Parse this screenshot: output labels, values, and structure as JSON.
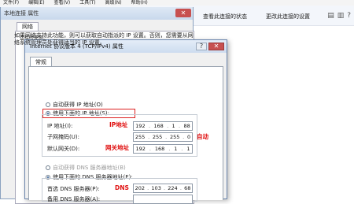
{
  "menubar": {
    "items": [
      "文件(F)",
      "编辑(E)",
      "查看(V)",
      "工具(T)",
      "高级(N)",
      "帮助(H)"
    ]
  },
  "bg_toolbar": {
    "view_status": "查看此连接的状态",
    "change_settings": "更改此连接的设置"
  },
  "bg_dialog": {
    "title": "本地连接 属性",
    "tab": "网络",
    "line": "连接时使用:"
  },
  "dialog": {
    "title": "Internet 协议版本 4 (TCP/IPv4) 属性",
    "tab": "常规",
    "description": "如果网络支持此功能，则可以获取自动指派的 IP 设置。否则，您需要从网络系统管理员处获得适当的 IP 设置。",
    "auto_ip": "自动获得 IP 地址(O)",
    "use_ip": "使用下面的 IP 地址(S):",
    "ip_label": "IP 地址(I):",
    "mask_label": "子网掩码(U):",
    "gateway_label": "默认网关(D):",
    "ip_value": [
      "192",
      "168",
      "1",
      "88"
    ],
    "mask_value": [
      "255",
      "255",
      "255",
      "0"
    ],
    "gateway_value": [
      "192",
      "168",
      "1",
      "1"
    ],
    "auto_dns": "自动获得 DNS 服务器地址(B)",
    "use_dns": "使用下面的 DNS 服务器地址(E):",
    "dns1_label": "首选 DNS 服务器(P):",
    "dns2_label": "备用 DNS 服务器(A):",
    "dns1_value": [
      "202",
      "103",
      "224",
      "68"
    ]
  },
  "annotations": {
    "ip": "IP地址",
    "auto": "自动",
    "gateway": "网关地址",
    "dns": "DNS"
  },
  "colors": {
    "annotation": "#e01010",
    "highlight": "#dd2222",
    "title_bar": "#cddcef"
  }
}
